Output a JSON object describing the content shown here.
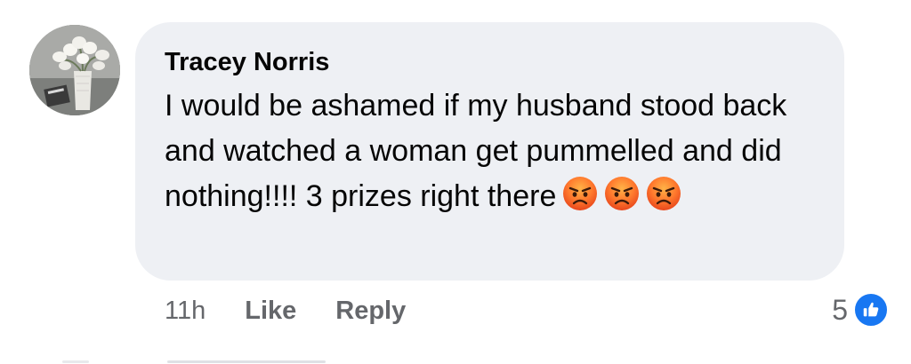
{
  "comment": {
    "author": "Tracey Norris",
    "text": "I would be ashamed if my husband stood back and watched a woman get pummelled and did nothing!!!! 3 prizes right there",
    "emojis": [
      "angry-face",
      "angry-face",
      "angry-face"
    ]
  },
  "actions": {
    "time": "11h",
    "like_label": "Like",
    "reply_label": "Reply"
  },
  "reactions": {
    "count": "5",
    "type": "like-icon",
    "color": "#1877f2"
  },
  "colors": {
    "bubble": "#eef0f4",
    "meta_text": "#65676b",
    "accent": "#1877f2"
  }
}
